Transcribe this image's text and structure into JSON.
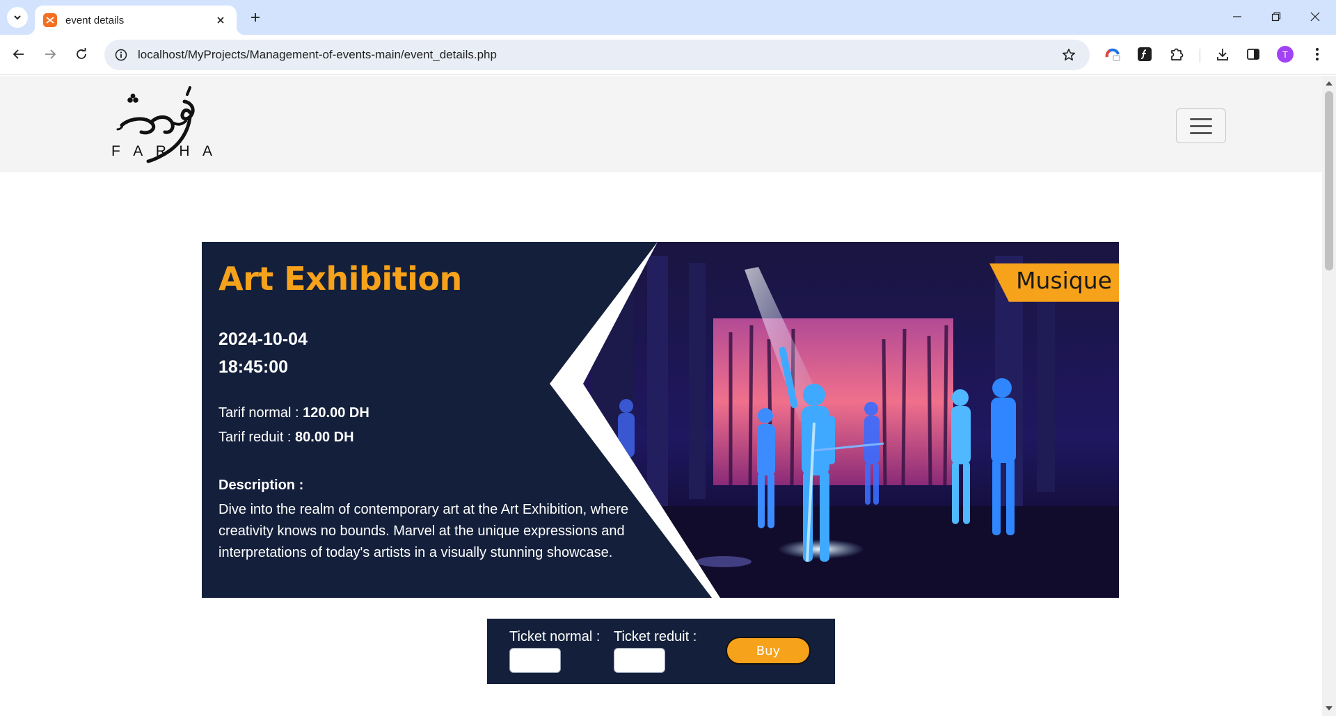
{
  "browser": {
    "tab_title": "event details",
    "url": "localhost/MyProjects/Management-of-events-main/event_details.php",
    "profile_initial": "T"
  },
  "header": {
    "logo_letters": [
      "F",
      "A",
      "R",
      "H",
      "A"
    ]
  },
  "event": {
    "title": "Art Exhibition",
    "date": "2024-10-04",
    "time": "18:45:00",
    "tarif_normal_label": "Tarif normal : ",
    "tarif_normal_value": "120.00 DH",
    "tarif_reduit_label": "Tarif reduit : ",
    "tarif_reduit_value": "80.00 DH",
    "description_label": "Description :",
    "description": "Dive into the realm of contemporary art at the Art Exhibition, where creativity knows no bounds. Marvel at the unique expressions and interpretations of today's artists in a visually stunning showcase.",
    "category": "Musique"
  },
  "tickets": {
    "normal_label": "Ticket normal :",
    "reduit_label": "Ticket reduit :",
    "normal_value": "",
    "reduit_value": "",
    "buy_label": "Buy"
  },
  "colors": {
    "accent": "#f7a21b",
    "card_bg": "#14203b",
    "header_bg": "#f4f4f4",
    "tab_strip": "#d3e3fd"
  }
}
